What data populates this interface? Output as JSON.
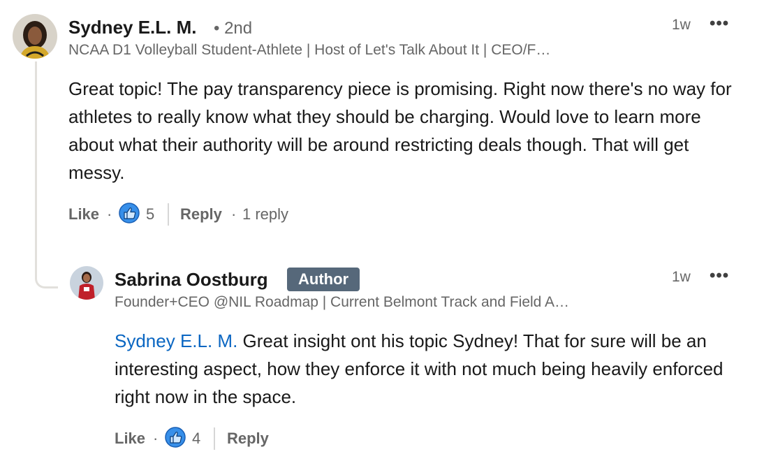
{
  "comment": {
    "author_name": "Sydney E.L. M.",
    "degree": "• 2nd",
    "headline": "NCAA D1 Volleyball Student-Athlete | Host of Let's Talk About It | CEO/F…",
    "time": "1w",
    "more_label": "•••",
    "body": "Great topic! The pay transparency piece is promising. Right now there's no way for athletes to really know what they should be charging. Would love to learn more about what their authority will be around restricting deals though. That will get messy.",
    "like_label": "Like",
    "dot": "·",
    "reaction_icon": "like-thumb-icon",
    "reaction_count": "5",
    "reply_label": "Reply",
    "reply_count": "1 reply"
  },
  "reply": {
    "author_name": "Sabrina Oostburg",
    "badge": "Author",
    "headline": "Founder+CEO @NIL Roadmap | Current Belmont Track and Field A…",
    "time": "1w",
    "more_label": "•••",
    "mention": "Sydney E.L. M.",
    "body": " Great insight ont his topic Sydney! That for sure will be an interesting aspect, how they enforce it with not much being heavily enforced right now in the space.",
    "like_label": "Like",
    "dot": "·",
    "reaction_icon": "like-thumb-icon",
    "reaction_count": "4",
    "reply_label": "Reply"
  },
  "colors": {
    "link": "#0a66c2",
    "badge_bg": "#56687a",
    "like_blue": "#378fe9"
  }
}
